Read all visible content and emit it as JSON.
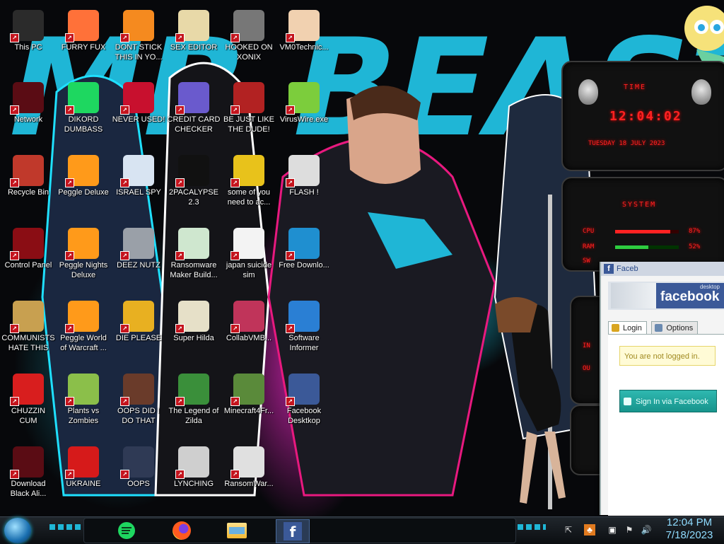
{
  "desktop": {
    "icons": [
      {
        "label": "This PC",
        "icon": "computer-icon",
        "color": "#2b2b2b"
      },
      {
        "label": "FURRY FUX",
        "icon": "firefox-icon",
        "color": "#ff7139"
      },
      {
        "label": "DONT STICK THIS IN YO...",
        "icon": "vlc-cone-icon",
        "color": "#f58a1f"
      },
      {
        "label": "SEX EDITOR",
        "icon": "hxd-editor-icon",
        "color": "#e8d9a8"
      },
      {
        "label": "HOOKED ON XONIX",
        "icon": "xonix-game-icon",
        "color": "#777777"
      },
      {
        "label": "VM0Technic...",
        "icon": "doctor-icon",
        "color": "#f1d1b0"
      },
      {
        "label": "Network",
        "icon": "alien-orb-icon",
        "color": "#5a0c14"
      },
      {
        "label": "DIKORD DUMBASS",
        "icon": "spotify-like-icon",
        "color": "#1ed760"
      },
      {
        "label": "NEVER USED!",
        "icon": "dev-cpp-icon",
        "color": "#c8102e"
      },
      {
        "label": "CREDIT CARD CHECKER",
        "icon": "credit-card-icon",
        "color": "#6a5acd"
      },
      {
        "label": "BE JUST LIKE THE DUDE!",
        "icon": "santa-icon",
        "color": "#b22222"
      },
      {
        "label": "VirusWire.exe",
        "icon": "lime-icon",
        "color": "#7ccd3c"
      },
      {
        "label": "Recycle Bin",
        "icon": "recycle-bin-icon",
        "color": "#c0392b"
      },
      {
        "label": "Peggle Deluxe",
        "icon": "peggle-icon",
        "color": "#ff9a1a"
      },
      {
        "label": "ISRAEL SPY",
        "icon": "webcam-icon",
        "color": "#d8e4f2"
      },
      {
        "label": "2PACALYPSE 2.3",
        "icon": "terminal-icon",
        "color": "#111111"
      },
      {
        "label": "some of you need to ac...",
        "icon": "beaver-icon",
        "color": "#e8c21b"
      },
      {
        "label": "FLASH !",
        "icon": "flash-icon",
        "color": "#dddddd"
      },
      {
        "label": "Control Panel",
        "icon": "control-panel-icon",
        "color": "#8a0d14"
      },
      {
        "label": "Peggle Nights Deluxe",
        "icon": "peggle-nights-icon",
        "color": "#ff9a1a"
      },
      {
        "label": "DEEZ NUTZ",
        "icon": "windows-stack-icon",
        "color": "#9aa0a8"
      },
      {
        "label": "Ransomware Maker Build...",
        "icon": "window-app-icon",
        "color": "#cfe7cf"
      },
      {
        "label": "japan suicide sim",
        "icon": "file-download-icon",
        "color": "#f3f3f3"
      },
      {
        "label": "Free Downlo...",
        "icon": "arrow-app-icon",
        "color": "#1f8fd0"
      },
      {
        "label": "COMMUNISTS HATE THIS G...",
        "icon": "money-bag-icon",
        "color": "#c8a050"
      },
      {
        "label": "Peggle World of Warcraft ...",
        "icon": "peggle-wow-icon",
        "color": "#ff9a1a"
      },
      {
        "label": "DIE PLEASE",
        "icon": "de-icon",
        "color": "#e8b021"
      },
      {
        "label": "Super Hilda",
        "icon": "pixel-game-icon",
        "color": "#e6e0c8"
      },
      {
        "label": "CollabVMB...",
        "icon": "collabvm-icon",
        "color": "#c0345a"
      },
      {
        "label": "Software Informer",
        "icon": "software-informer-icon",
        "color": "#2a7fd4"
      },
      {
        "label": "CHUZZIN CUM",
        "icon": "chuzzle-icon",
        "color": "#d81e1e"
      },
      {
        "label": "Plants vs Zombies",
        "icon": "pvz-icon",
        "color": "#8bbf4a"
      },
      {
        "label": "OOPS DID I DO THAT",
        "icon": "portrait-icon",
        "color": "#6a3b2a"
      },
      {
        "label": "The Legend of Zilda",
        "icon": "zelda-icon",
        "color": "#3a8f3a"
      },
      {
        "label": "Minecraft4Fr...",
        "icon": "minecraft-block-icon",
        "color": "#5a8a3a"
      },
      {
        "label": "Facebook Desktkop",
        "icon": "facebook-icon",
        "color": "#3b5998"
      },
      {
        "label": "Download Black Ali...",
        "icon": "alien-orb-icon",
        "color": "#5a0c14"
      },
      {
        "label": "UKRAINE",
        "icon": "radiation-icon",
        "color": "#d61a1a"
      },
      {
        "label": "OOPS",
        "icon": "book-icon",
        "color": "#2f3a55"
      },
      {
        "label": "LYNCHING",
        "icon": "rope-icon",
        "color": "#cfcfcf"
      },
      {
        "label": "RansomWar...",
        "icon": "skull-icon",
        "color": "#e0e0e0"
      }
    ]
  },
  "wallpaper": {
    "headline": "MR BEAST",
    "colors": {
      "cyan": "#1fb6d6",
      "pink": "#e8197f",
      "purple": "#7a2bd6"
    }
  },
  "gadget": {
    "time_label": "TIME",
    "time": "12:04:02",
    "date": "TUESDAY 18 JULY 2023",
    "system_label": "SYSTEM",
    "cpu_label": "CPU",
    "cpu_value": "87%",
    "cpu_fraction": 0.87,
    "ram_label": "RAM",
    "ram_value": "52%",
    "ram_fraction": 0.52,
    "sw_label": "SW",
    "in_label": "IN",
    "ou_label": "OU"
  },
  "facebook": {
    "window_title": "Faceb",
    "brand": "facebook",
    "brand_sub": "desktop",
    "tabs": [
      "Login",
      "Options"
    ],
    "status": "You are not logged in.",
    "sign_in": "Sign In via Facebook",
    "brand_color": "#3b5998"
  },
  "taskbar": {
    "time": "12:04 PM",
    "date": "7/18/2023",
    "pinned": [
      "spotify-like-icon",
      "firefox-icon",
      "file-explorer-icon",
      "facebook-icon"
    ]
  }
}
